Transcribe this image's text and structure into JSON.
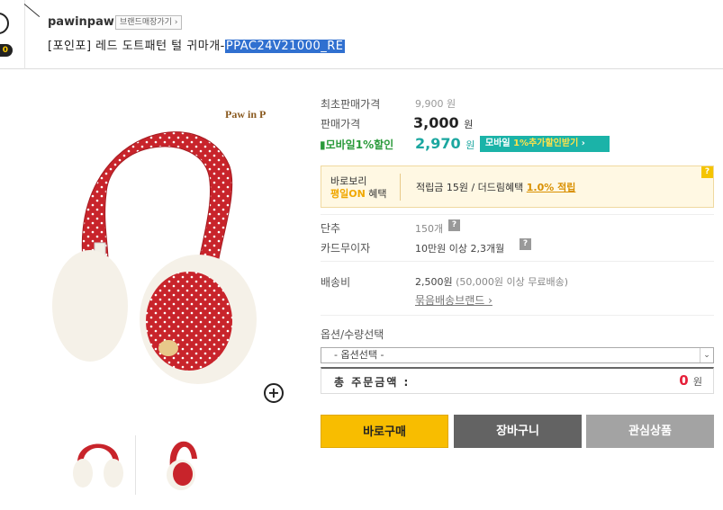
{
  "header": {
    "corner_badge_number": "0",
    "brand_name": "pawinpaw",
    "brand_link": "브랜드매장가기 ›",
    "title_prefix": "[포인포] 레드 도트패턴 털 귀마개-",
    "title_code": "PPAC24V21000_RE"
  },
  "product_image": {
    "brand_logo": "Paw in Paw",
    "main_color": "#c8242b",
    "fur_color": "#f5f1e8"
  },
  "price": {
    "orig_label": "최초판매가격",
    "orig_value": "9,900 원",
    "sale_label": "판매가격",
    "sale_value": "3,000",
    "sale_unit": "원",
    "mobile_label": "▮모바일1%할인",
    "mobile_value": "2,970",
    "mobile_unit": "원",
    "coupon_prefix": "모바일 ",
    "coupon_highlight": "1%추가할인받기",
    "coupon_suffix": " ›"
  },
  "benefit": {
    "line1": "바로보리",
    "line2_highlight": "평일ON",
    "line2_suffix": " 혜택",
    "text": "적립금 15원 / 더드림혜택 ",
    "link": "1.0% 적립",
    "help": "?"
  },
  "info": {
    "stock_label": "단추",
    "stock_value": "150개",
    "card_label": "카드무이자",
    "card_value": "10만원 이상 2,3개월",
    "ship_label": "배송비",
    "ship_value": "2,500원",
    "ship_note": "(50,000원 이상 무료배송)",
    "bundle_link": "묶음배송브랜드 ›",
    "help": "?"
  },
  "option": {
    "label": "옵션/수량선택",
    "select_value": "- 옵션선택 -",
    "arrow": "⌄"
  },
  "total": {
    "label": "총 주문금액 :",
    "value": "0",
    "unit": "원"
  },
  "buttons": {
    "buy": "바로구매",
    "cart": "장바구니",
    "wish": "관심상품"
  },
  "zoom_label": "+"
}
